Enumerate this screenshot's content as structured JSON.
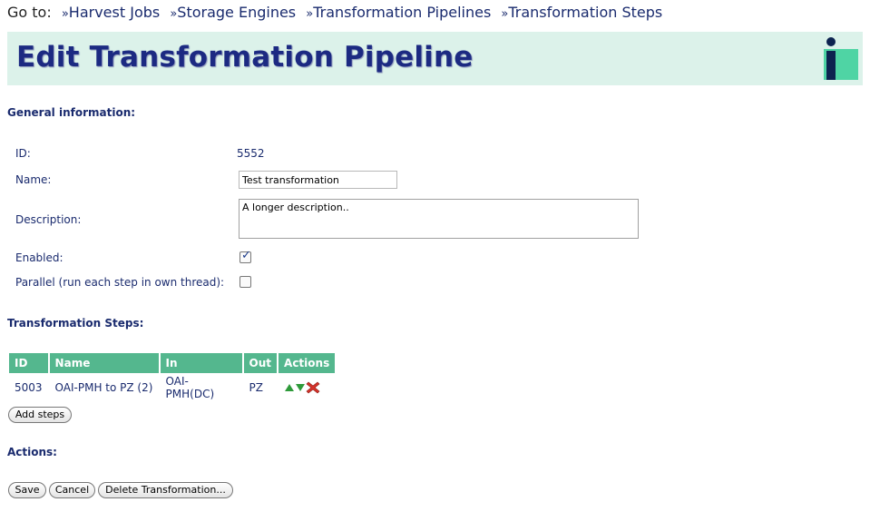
{
  "nav": {
    "goto_label": "Go to:",
    "links": [
      {
        "arrow": "»",
        "label": "Harvest Jobs"
      },
      {
        "arrow": "»",
        "label": "Storage Engines"
      },
      {
        "arrow": "»",
        "label": "Transformation Pipelines"
      },
      {
        "arrow": "»",
        "label": "Transformation Steps"
      }
    ]
  },
  "banner": {
    "title": "Edit Transformation Pipeline",
    "logo_icon": "info-logo-icon",
    "logo_letter": "i"
  },
  "general": {
    "heading": "General information:",
    "id_label": "ID:",
    "id_value": "5552",
    "name_label": "Name:",
    "name_value": "Test transformation",
    "description_label": "Description:",
    "description_value": "A longer description..",
    "enabled_label": "Enabled:",
    "enabled_checked": true,
    "parallel_label": "Parallel (run each step in own thread):",
    "parallel_checked": false
  },
  "steps": {
    "heading": "Transformation Steps:",
    "columns": [
      "ID",
      "Name",
      "In",
      "Out",
      "Actions"
    ],
    "rows": [
      {
        "id": "5003",
        "name": "OAI-PMH to PZ (2)",
        "in": "OAI-PMH(DC)",
        "out": "PZ",
        "actions": [
          "move-up-icon",
          "move-down-icon",
          "delete-icon"
        ]
      }
    ],
    "add_button": "Add steps"
  },
  "actions": {
    "heading": "Actions:",
    "save": "Save",
    "cancel": "Cancel",
    "delete": "Delete Transformation..."
  },
  "colors": {
    "banner_bg": "#dcf2ea",
    "header_bg": "#54b78e",
    "text": "#1a2b6e",
    "logo_accent": "#4fd4a4"
  }
}
